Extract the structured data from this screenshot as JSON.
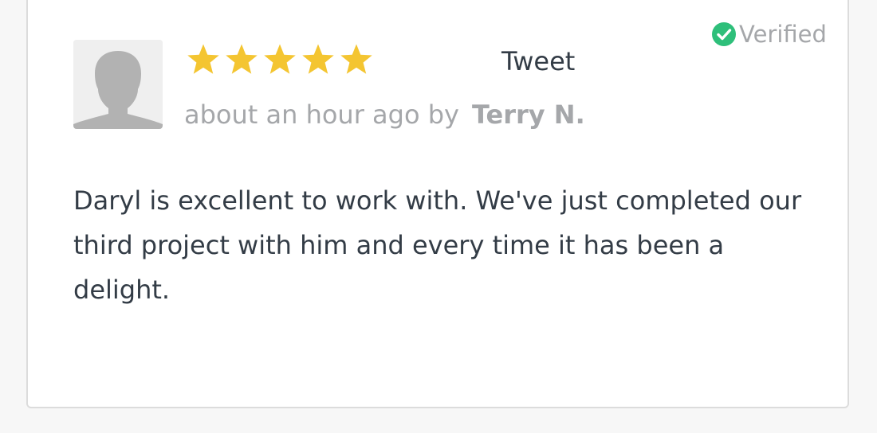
{
  "review": {
    "rating": 5,
    "rating_max": 5,
    "tweet_label": "Tweet",
    "verified_label": "Verified",
    "time_ago": "about an hour ago by",
    "author": "Terry N.",
    "text": "Daryl is excellent to work with. We've just completed our third project with him and every time it has been a delight."
  },
  "colors": {
    "star": "#f4c531",
    "verified_check": "#2ebf7a",
    "text_primary": "#333c46",
    "text_muted": "#a5a7aa"
  },
  "icons": {
    "avatar": "person-silhouette-icon",
    "star": "star-icon",
    "verified": "check-circle-icon"
  }
}
